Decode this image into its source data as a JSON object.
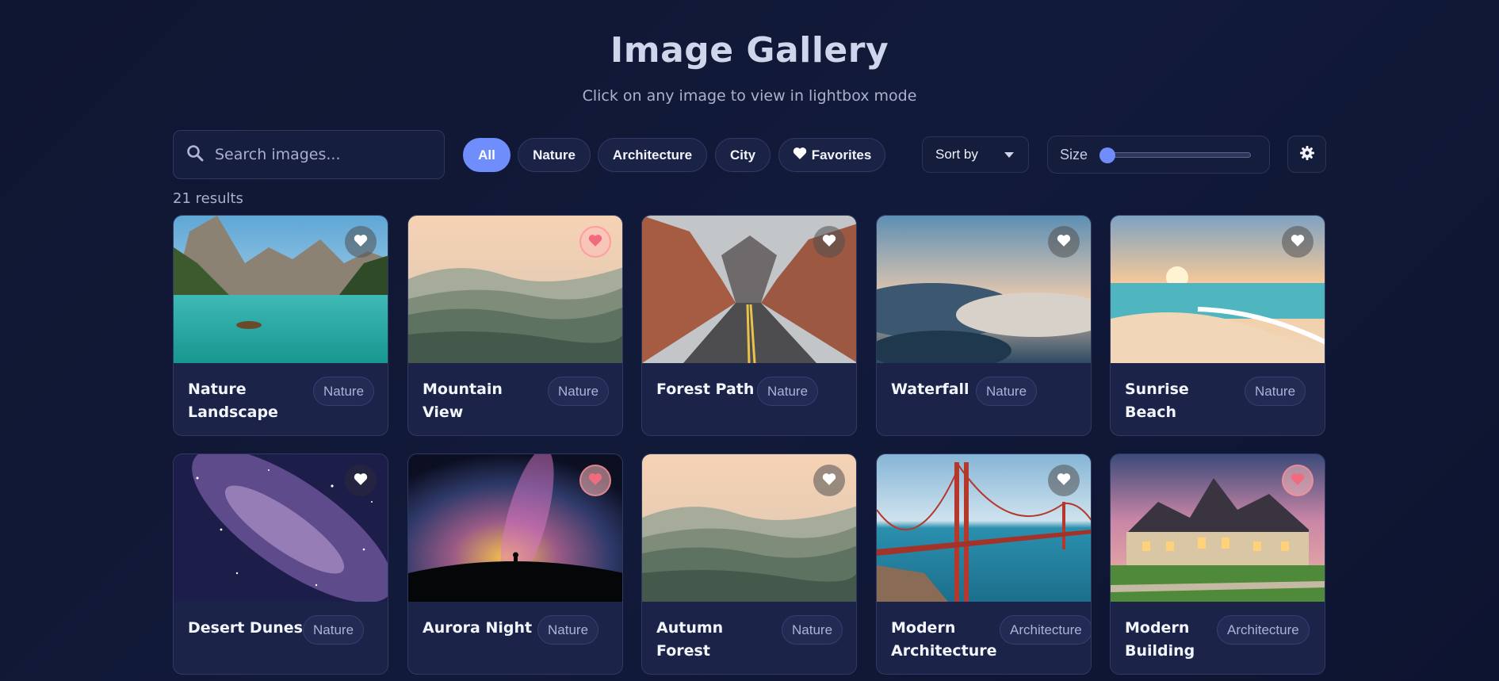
{
  "header": {
    "title": "Image Gallery",
    "subtitle": "Click on any image to view in lightbox mode"
  },
  "search": {
    "placeholder": "Search images...",
    "value": "",
    "icon": "search-icon"
  },
  "filters": [
    {
      "label": "All",
      "active": true
    },
    {
      "label": "Nature",
      "active": false
    },
    {
      "label": "Architecture",
      "active": false
    },
    {
      "label": "City",
      "active": false
    },
    {
      "label": "Favorites",
      "active": false,
      "icon": "heart-icon"
    }
  ],
  "sort": {
    "label": "Sort by"
  },
  "size": {
    "label": "Size",
    "value": 0
  },
  "settings": {
    "icon": "gear-icon"
  },
  "results": {
    "text": "21 results"
  },
  "colors": {
    "accent": "#6f8dfb",
    "favorite": "#f06b7e",
    "background": "#0f1631",
    "card": "#1b2348"
  },
  "cards": [
    {
      "title": "Nature Landscape",
      "tag": "Nature",
      "favorite": false
    },
    {
      "title": "Mountain View",
      "tag": "Nature",
      "favorite": true
    },
    {
      "title": "Forest Path",
      "tag": "Nature",
      "favorite": false
    },
    {
      "title": "Waterfall",
      "tag": "Nature",
      "favorite": false
    },
    {
      "title": "Sunrise Beach",
      "tag": "Nature",
      "favorite": false
    },
    {
      "title": "Desert Dunes",
      "tag": "Nature",
      "favorite": false
    },
    {
      "title": "Aurora Night",
      "tag": "Nature",
      "favorite": true
    },
    {
      "title": "Autumn Forest",
      "tag": "Nature",
      "favorite": false
    },
    {
      "title": "Modern Architecture",
      "tag": "Architecture",
      "favorite": false
    },
    {
      "title": "Modern Building",
      "tag": "Architecture",
      "favorite": true
    }
  ]
}
